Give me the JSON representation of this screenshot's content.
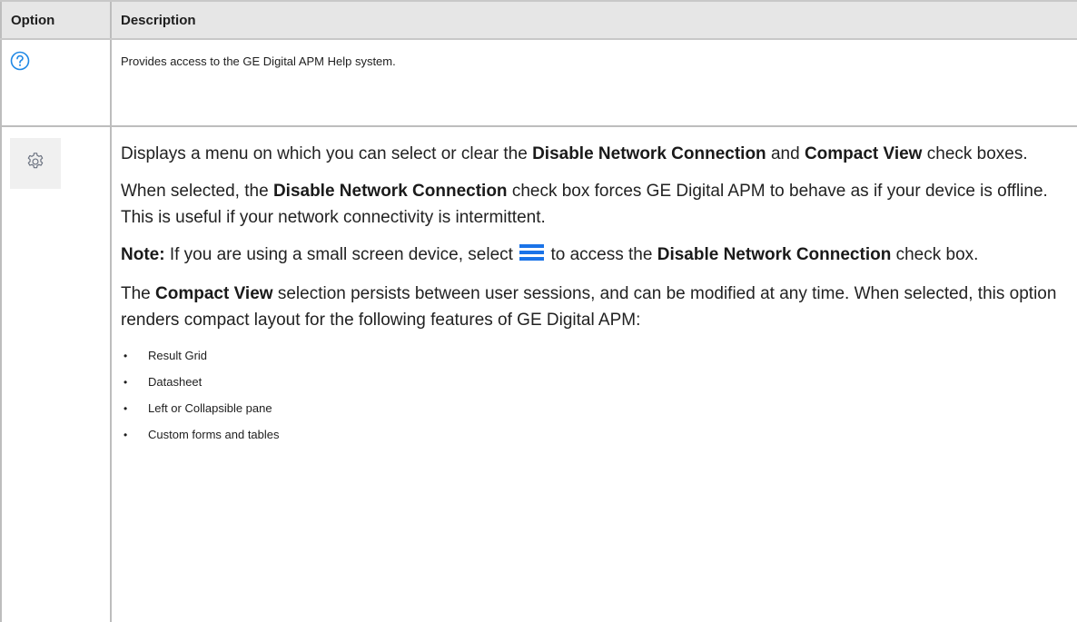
{
  "table": {
    "header": {
      "option": "Option",
      "description": "Description"
    },
    "help_row": {
      "icon": "question-circle-icon",
      "description": "Provides access to the GE Digital APM Help system."
    },
    "settings_row": {
      "icon": "gear-icon",
      "p1": {
        "t1": "Displays a menu on which you can select or clear the ",
        "b1": "Disable Network Connection",
        "t2": " and ",
        "b2": "Compact View",
        "t3": " check boxes."
      },
      "p2": {
        "t1": "When selected, the ",
        "b1": "Disable Network Connection",
        "t2": " check box forces GE Digital APM to behave as if your device is offline. This is useful if your network connectivity is intermittent."
      },
      "p3": {
        "b0": "Note:",
        "t1": " If you are using a small screen device, select ",
        "menu_icon": "hamburger-menu-icon",
        "t2": " to access the ",
        "b1": "Disable Network Connection",
        "t3": " check box."
      },
      "p4": {
        "t1": "The ",
        "b1": "Compact View",
        "t2": " selection persists between user sessions, and can be modified at any time. When selected, this option renders compact layout for the following features of GE Digital APM:"
      },
      "features": [
        "Result Grid",
        "Datasheet",
        "Left or Collapsible pane",
        "Custom forms and tables"
      ]
    }
  },
  "colors": {
    "header_bg": "#e6e6e6",
    "border": "#bdbdbd",
    "icon_blue": "#1e88e5",
    "menu_icon_blue": "#1a73e8",
    "gear_gray": "#6b7280"
  }
}
